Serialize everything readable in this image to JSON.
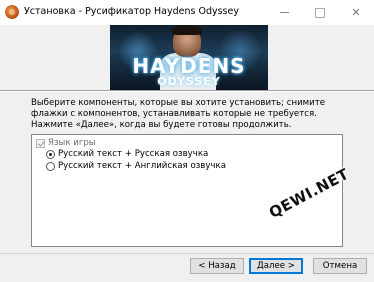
{
  "window": {
    "title": "Установка - Русификатор Haydens Odyssey",
    "minimize_icon": "minimize-icon",
    "maximize_icon": "maximize-icon",
    "close_icon": "close-icon"
  },
  "banner": {
    "logo_line1": "HAYDENS",
    "logo_line2": "ODYSSEY"
  },
  "description": "Выберите компоненты, которые вы хотите установить; снимите флажки с компонентов, устанавливать которые не требуется. Нажмите «Далее», когда вы будете готовы продолжить.",
  "components": {
    "group": {
      "label": "Язык игры",
      "checked": true,
      "enabled": false
    },
    "options": [
      {
        "label": "Русский текст + Русская озвучка",
        "selected": true
      },
      {
        "label": "Русский текст + Английская озвучка",
        "selected": false
      }
    ]
  },
  "watermark": "QEWI.NET",
  "buttons": {
    "back": "< Назад",
    "next": "Далее >",
    "cancel": "Отмена"
  },
  "colors": {
    "focus_border": "#0078d7",
    "dialog_bg": "#f0f0f0"
  }
}
